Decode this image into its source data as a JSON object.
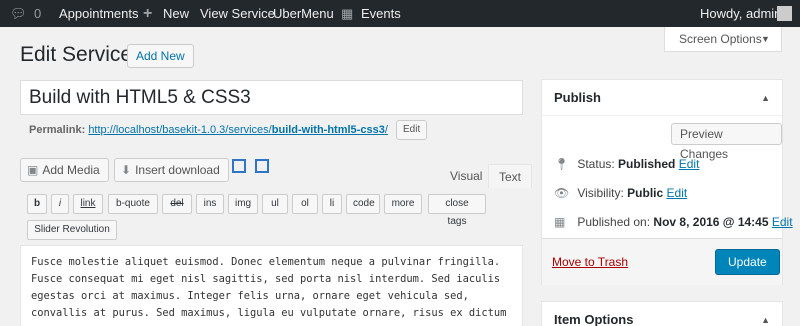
{
  "adminbar": {
    "comments_count": "0",
    "appointments": "Appointments",
    "new": "New",
    "view_service": "View Service",
    "ubermenu": "UberMenu",
    "events": "Events",
    "howdy": "Howdy, admin"
  },
  "screen_options": "Screen Options",
  "page": {
    "title": "Edit Service",
    "add_new": "Add New"
  },
  "post": {
    "title": "Build with HTML5 & CSS3",
    "permalink_label": "Permalink:",
    "permalink_base": "http://localhost/basekit-1.0.3/services/",
    "permalink_slug": "build-with-html5-css3",
    "permalink_end": "/",
    "edit_label": "Edit"
  },
  "media": {
    "add_media": "Add Media",
    "insert_download": "Insert download"
  },
  "tabs": {
    "visual": "Visual",
    "text": "Text"
  },
  "quicktags": [
    "b",
    "i",
    "link",
    "b-quote",
    "del",
    "ins",
    "img",
    "ul",
    "ol",
    "li",
    "code",
    "more",
    "close tags"
  ],
  "slider_revolution": "Slider Revolution",
  "content_lines": [
    "Fusce molestie aliquet euismod. Donec elementum neque a pulvinar fringilla.",
    "Fusce consequat mi eget nisl sagittis, sed porta nisl interdum. Sed iaculis",
    "egestas orci at maximus. Integer felis urna, ornare eget vehicula sed,",
    "convallis at purus. Sed maximus, ligula eu vulputate ornare, risus ex dictum"
  ],
  "publish": {
    "title": "Publish",
    "preview_changes": "Preview Changes",
    "status_label": "Status:",
    "status_value": "Published",
    "visibility_label": "Visibility:",
    "visibility_value": "Public",
    "published_label": "Published on:",
    "published_value": "Nov 8, 2016 @ 14:45",
    "edit": "Edit",
    "move_to_trash": "Move to Trash",
    "update": "Update"
  },
  "item_options": {
    "title": "Item Options"
  },
  "colors": {
    "admin_bar": "#23282d",
    "link": "#0073aa",
    "primary_button": "#0085ba",
    "trash": "#a00"
  }
}
